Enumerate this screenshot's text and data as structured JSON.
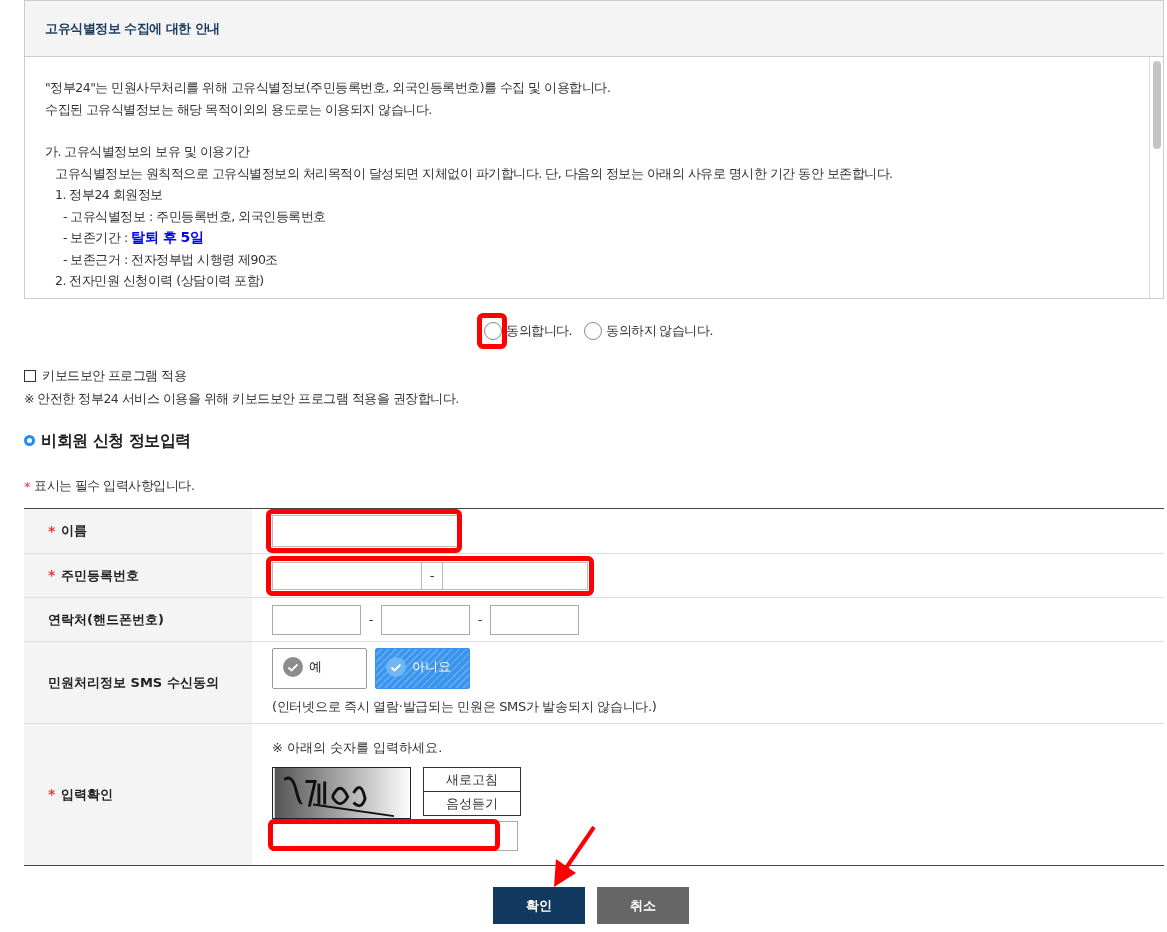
{
  "notice": {
    "title": "고유식별정보 수집에 대한 안내",
    "intro": [
      "\"정부24\"는 민원사무처리를 위해 고유식별정보(주민등록번호, 외국인등록번호)를 수집 및 이용합니다.",
      "수집된 고유식별정보는 해당 목적이외의 용도로는 이용되지 않습니다."
    ],
    "sections": [
      {
        "title": "가. 고유식별정보의 보유 및 이용기간",
        "text": "고유식별정보는 원칙적으로 고유식별정보의 처리목적이 달성되면 지체없이 파기합니다. 단, 다음의 정보는 아래의 사유로 명시한 기간 동안 보존합니다.",
        "items": [
          {
            "title": "1. 정부24 회원정보",
            "children": [
              "- 고유식별정보 : 주민등록번호, 외국인등록번호",
              "- 보존기간 : **탈퇴 후 5일**",
              "- 보존근거 : 전자정부법 시행령 제90조"
            ]
          },
          {
            "title": "2. 전자민원 신청이력 (상담이력 포함)"
          }
        ]
      }
    ]
  },
  "consent": [
    {
      "label": "동의합니다.",
      "selected": false
    },
    {
      "label": "동의하지 않습니다.",
      "selected": false
    }
  ],
  "keyboard_security": {
    "label": "키보드보안 프로그램 적용",
    "checked": false,
    "note": "※ 안전한 정부24 서비스 이용을 위해 키보드보안 프로그램 적용을 권장합니다."
  },
  "section_title": "비회원 신청 정보입력",
  "required_note": {
    "mark": "*",
    "text": "표시는 필수 입력사항입니다."
  },
  "form": [
    {
      "kind": "name",
      "label": "이름",
      "required": true
    },
    {
      "kind": "rrn",
      "label": "주민등록번호",
      "required": true,
      "separator": "-"
    },
    {
      "kind": "phone",
      "label": "연락처(핸드폰번호)",
      "required": false,
      "separators": [
        "-",
        "-"
      ]
    },
    {
      "kind": "sms",
      "label": "민원처리정보 SMS 수신동의",
      "required": false,
      "options": [
        {
          "label": "예",
          "selected": false
        },
        {
          "label": "아니요",
          "selected": true
        }
      ],
      "note": "(인터넷으로 즉시 열람·발급되는 민원은 SMS가 발송되지 않습니다.)"
    },
    {
      "kind": "captcha",
      "label": "입력확인",
      "required": true,
      "instruction": "※ 아래의 숫자를 입력하세요.",
      "buttons": [
        "새로고침",
        "음성듣기"
      ]
    }
  ],
  "buttons": [
    {
      "label": "확인",
      "kind": "primary"
    },
    {
      "label": "취소",
      "kind": "secondary"
    }
  ]
}
